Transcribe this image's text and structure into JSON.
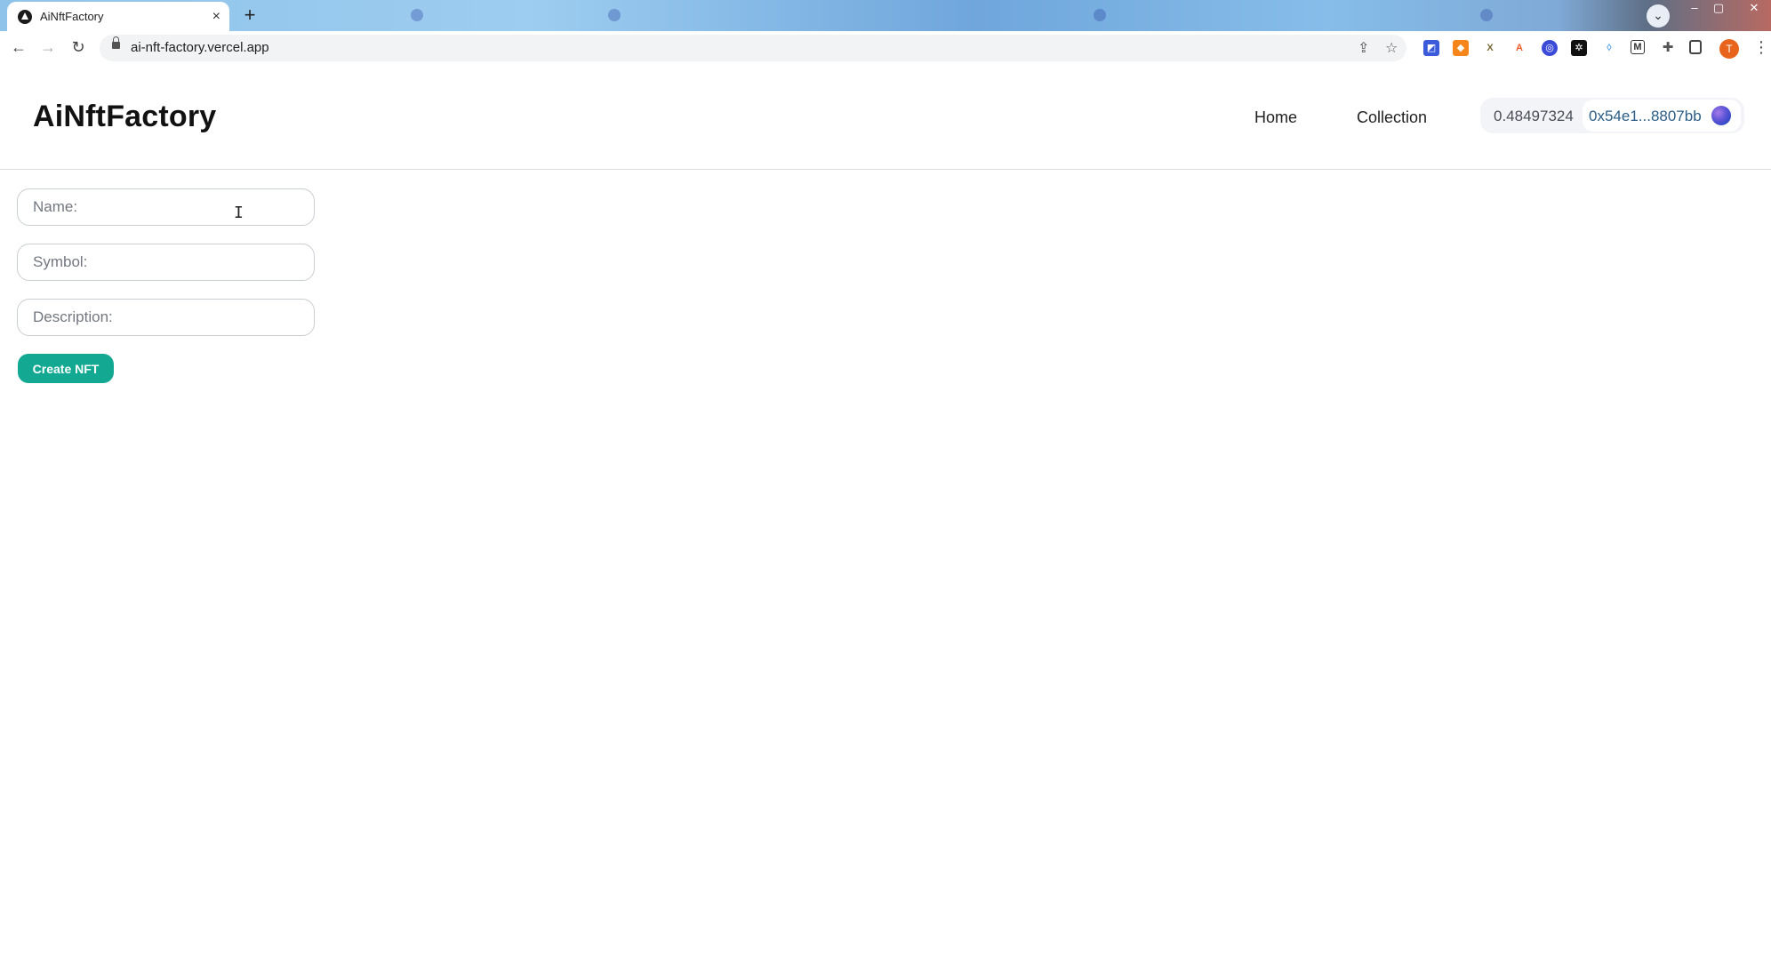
{
  "browser": {
    "tab_title": "AiNftFactory",
    "tab_close": "×",
    "new_tab": "+",
    "url": "ai-nft-factory.vercel.app",
    "profile_initial": "T",
    "nav": {
      "back": "←",
      "forward": "→",
      "reload": "↻"
    },
    "extensions": [
      {
        "name": "ext-1",
        "glyph": "◩",
        "color": "#3b5bdb"
      },
      {
        "name": "metamask",
        "glyph": "🦊",
        "color": "#f6851b"
      },
      {
        "name": "ext-3",
        "glyph": "X",
        "color": "#7a6a3a"
      },
      {
        "name": "ext-4",
        "glyph": "A",
        "color": "#f05a28"
      },
      {
        "name": "ext-5",
        "glyph": "◎",
        "color": "#3b4bd8"
      },
      {
        "name": "ext-6",
        "glyph": "✲",
        "color": "#111111"
      },
      {
        "name": "ext-7",
        "glyph": "◊",
        "color": "#5aa6e8"
      },
      {
        "name": "ext-8",
        "glyph": "M",
        "color": "#333333"
      }
    ]
  },
  "site": {
    "logo": "AiNftFactory",
    "nav": {
      "home": "Home",
      "collection": "Collection"
    },
    "wallet": {
      "balance": "0.48497324",
      "address": "0x54e1...8807bb"
    }
  },
  "form": {
    "name_placeholder": "Name:",
    "symbol_placeholder": "Symbol:",
    "description_placeholder": "Description:",
    "submit_label": "Create NFT"
  },
  "colors": {
    "accent": "#12a892",
    "address": "#2b5d86"
  }
}
